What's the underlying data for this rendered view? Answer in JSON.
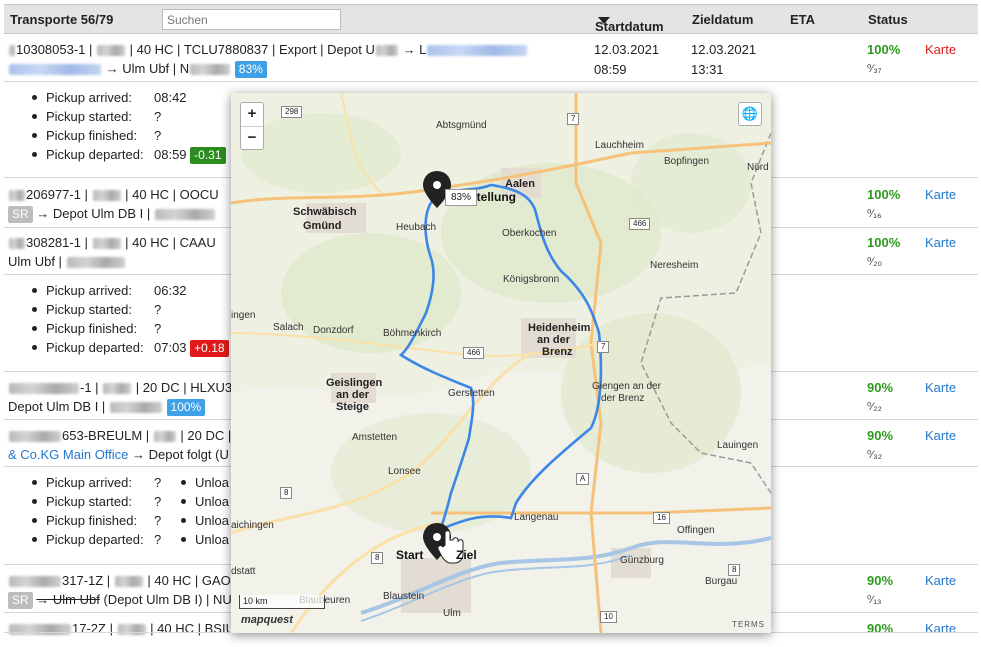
{
  "header": {
    "title": "Transporte 56/79",
    "search_placeholder": "Suchen",
    "col_start": "Startdatum",
    "col_ziel": "Zieldatum",
    "col_eta": "ETA",
    "col_status": "Status"
  },
  "rows": [
    {
      "line1": "10308053-1 | ",
      "line1b": " | 40 HC | TCLU7880837 | Export | Depot U",
      "line1c": " → L",
      "line2": " → Ulm Ubf | N",
      "badge": "83%",
      "start_date": "12.03.2021",
      "start_time": "08:59",
      "ziel_date": "12.03.2021",
      "ziel_time": "13:31",
      "status_pct": "100%",
      "status_frac": "⁰⁄₃₇",
      "map_link": "Karte"
    },
    {
      "line1": "206977-1 | ",
      "line1b": " | 40 HC | OOCU",
      "sr": "SR",
      "line2": "→ Depot Ulm DB I | ",
      "status_pct": "100%",
      "status_frac": "⁰⁄₁₆",
      "map_link": "Karte"
    },
    {
      "line1": "308281-1 | ",
      "line1b": " | 40 HC | CAAU",
      "line2": "Ulm Ubf | ",
      "status_pct": "100%",
      "status_frac": "⁰⁄₂₀",
      "map_link": "Karte"
    },
    {
      "line1": "-1 | ",
      "line1b": " | 20 DC | HLXU3",
      "line2": "Depot Ulm DB I | ",
      "badge": "100%",
      "status_pct": "90%",
      "status_frac": "⁰⁄₂₂",
      "map_link": "Karte"
    },
    {
      "line1": "653-BREULM | ",
      "line1b": " | 20 DC | T",
      "line2a": "& Co.KG Main Office",
      "line2b": " → Depot folgt (U",
      "status_pct": "90%",
      "status_frac": "⁰⁄₃₂",
      "map_link": "Karte"
    },
    {
      "line1": "317-1Z | ",
      "line1b": " | 40 HC | GAO",
      "sr": "SR",
      "line2a": "→ Ulm Ubf",
      "line2b": " (Depot Ulm DB I) | NU",
      "status_pct": "90%",
      "status_frac": "⁰⁄₁₃",
      "map_link": "Karte"
    },
    {
      "line1": "17-2Z | ",
      "line1b": " | 40 HC | BSIU5",
      "status_pct": "90%",
      "map_link": "Karte"
    }
  ],
  "pickups": [
    {
      "items": [
        {
          "label": "Pickup arrived:",
          "value": "08:42"
        },
        {
          "label": "Pickup started:",
          "value": "?"
        },
        {
          "label": "Pickup finished:",
          "value": "?"
        },
        {
          "label": "Pickup departed:",
          "value": "08:59",
          "badge": "-0.31"
        }
      ]
    },
    {
      "items": [
        {
          "label": "Pickup arrived:",
          "value": "06:32"
        },
        {
          "label": "Pickup started:",
          "value": "?"
        },
        {
          "label": "Pickup finished:",
          "value": "?"
        },
        {
          "label": "Pickup departed:",
          "value": "07:03",
          "badge": "+0.18"
        }
      ]
    },
    {
      "items": [
        {
          "label": "Pickup arrived:",
          "value": "?"
        },
        {
          "label": "Pickup started:",
          "value": "?"
        },
        {
          "label": "Pickup finished:",
          "value": "?"
        },
        {
          "label": "Pickup departed:",
          "value": "?"
        }
      ],
      "unload": [
        "Unloa",
        "Unloa",
        "Unloa",
        "Unloa"
      ]
    }
  ],
  "map": {
    "zoom_in": "+",
    "zoom_out": "−",
    "progress_popup": "83%",
    "dest_label": "stellung",
    "start_label": "Start",
    "ziel_label": "Ziel",
    "scale": "10 km",
    "logo": "mapquest",
    "terms": "TERMS",
    "places": {
      "abtsgmuend": "Abtsgmünd",
      "lauchheim": "Lauchheim",
      "bopfingen": "Bopfingen",
      "noerd": "Nörd",
      "schwaebisch": "Schwäbisch",
      "gmuend": "Gmünd",
      "aalen": "Aalen",
      "heubach": "Heubach",
      "oberkochen": "Oberkochen",
      "neresheim": "Neresheim",
      "koenigsbronn": "Königsbronn",
      "ingen": "ingen",
      "salach": "Salach",
      "donzdorf": "Donzdorf",
      "boehmenkirch": "Böhmenkirch",
      "heidenheim": "Heidenheim",
      "anderbrenz": "an der",
      "brenz": "Brenz",
      "geislingen": "Geislingen",
      "andersteige1": "an der",
      "steige": "Steige",
      "gerstetten": "Gerstetten",
      "giengen": "Giengen an der",
      "giengen2": "der Brenz",
      "amstetten": "Amstetten",
      "lauingen": "Lauingen",
      "lonsee": "Lonsee",
      "langenau": "Langenau",
      "offingen": "Offingen",
      "aichingen": "aichingen",
      "guenzburg": "Günzburg",
      "burgau": "Burgau",
      "dstatt": "dstatt",
      "blaustein": "Blaustein",
      "blaubeuren": "Blaubeuren",
      "ulm": "Ulm"
    },
    "roads": {
      "r298": "298",
      "r7a": "7",
      "r7b": "7",
      "r466a": "466",
      "r466b": "466",
      "r8a": "8",
      "r8b": "8",
      "r8c": "8",
      "r10": "10",
      "r16": "16",
      "rA": "A"
    }
  }
}
